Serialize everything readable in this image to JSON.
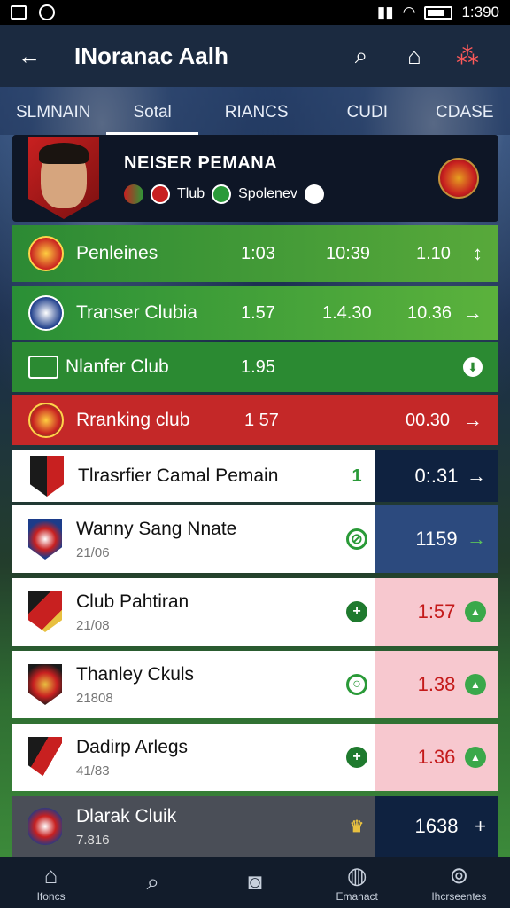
{
  "status": {
    "time": "1:390"
  },
  "appbar": {
    "title": "INoranac Aalh",
    "back_icon": "arrow-left-icon",
    "search_icon": "search-icon",
    "bell_icon": "notification-icon",
    "more_icon": "dots-icon"
  },
  "tabs": [
    {
      "label": "SLMNAIN"
    },
    {
      "label": "Sotal"
    },
    {
      "label": "RIANCS"
    },
    {
      "label": "CUDI"
    },
    {
      "label": "CDASE"
    }
  ],
  "profile": {
    "name": "NEISER PEMANA",
    "tag1": "Tlub",
    "tag2": "Spolenev"
  },
  "rows": [
    {
      "label": "Penleines",
      "a": "1:03",
      "b": "10:39",
      "c": "1.10",
      "arrow": "↕"
    },
    {
      "label": "Transer Clubia",
      "a": "1.57",
      "b": "1.4.30",
      "c": "10.36",
      "arrow": "→"
    },
    {
      "label": "Nlanfer Club",
      "a": "1.95",
      "arrow": "⬇"
    },
    {
      "label": "Rranking club",
      "a": "1 57",
      "c": "00.30",
      "arrow": "→"
    }
  ],
  "cards": [
    {
      "title": "Tlrasrfier Camal Pemain",
      "sub": "",
      "count": "1",
      "value": "0:.31",
      "arrow": "→"
    },
    {
      "title": "Wanny Sang Nnate",
      "sub": "21/06",
      "value": "1159",
      "arrow": "→"
    },
    {
      "title": "Club Pahtiran",
      "sub": "21/08",
      "value": "1:57",
      "arrow": "▲"
    },
    {
      "title": "Thanley Ckuls",
      "sub": "21808",
      "value": "1.38",
      "arrow": "▲"
    },
    {
      "title": "Dadirp Arlegs",
      "sub": "41/83",
      "value": "1.36",
      "arrow": "▲"
    },
    {
      "title": "Dlarak Cluik",
      "sub": "7.816",
      "value": "1638",
      "arrow": "+"
    }
  ],
  "nav": [
    {
      "label": "Ifoncs",
      "icon": "home-icon"
    },
    {
      "label": "",
      "icon": "search-icon"
    },
    {
      "label": "",
      "icon": "camera-icon"
    },
    {
      "label": "Emanact",
      "icon": "person-icon"
    },
    {
      "label": "Ihcrseentes",
      "icon": "profile-alert-icon"
    }
  ]
}
